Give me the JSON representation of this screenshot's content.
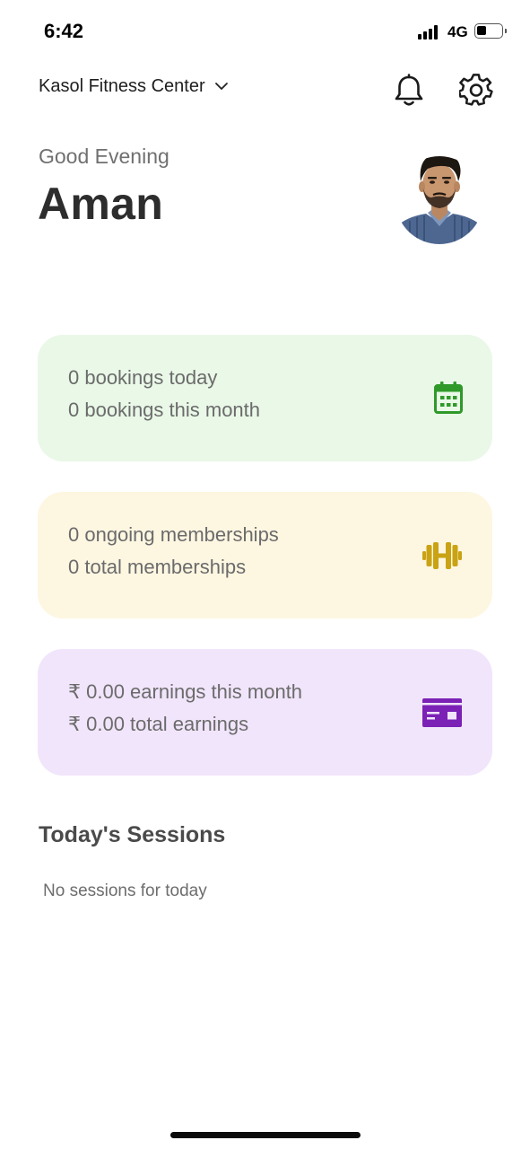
{
  "status_bar": {
    "time": "6:42",
    "network": "4G",
    "icons": [
      "signal-icon",
      "battery-icon"
    ]
  },
  "header": {
    "center_name": "Kasol Fitness Center",
    "icons": [
      "chevron-down-icon",
      "bell-icon",
      "gear-icon"
    ]
  },
  "greeting": {
    "salutation": "Good Evening",
    "name": "Aman"
  },
  "stats": {
    "bookings": {
      "line1": "0 bookings today",
      "line2": "0 bookings this month",
      "icon": "calendar-icon",
      "bg": "#e9f8e7",
      "accent": "#2f9a2a"
    },
    "memberships": {
      "line1": "0 ongoing memberships",
      "line2": "0 total memberships",
      "icon": "dumbbell-icon",
      "bg": "#fdf6e1",
      "accent": "#c9a313"
    },
    "earnings": {
      "line1": "₹ 0.00 earnings this month",
      "line2": "₹ 0.00 total earnings",
      "icon": "credit-card-icon",
      "bg": "#f1e5fb",
      "accent": "#7b21b5"
    }
  },
  "sessions": {
    "title": "Today's Sessions",
    "empty_text": "No sessions for today"
  }
}
